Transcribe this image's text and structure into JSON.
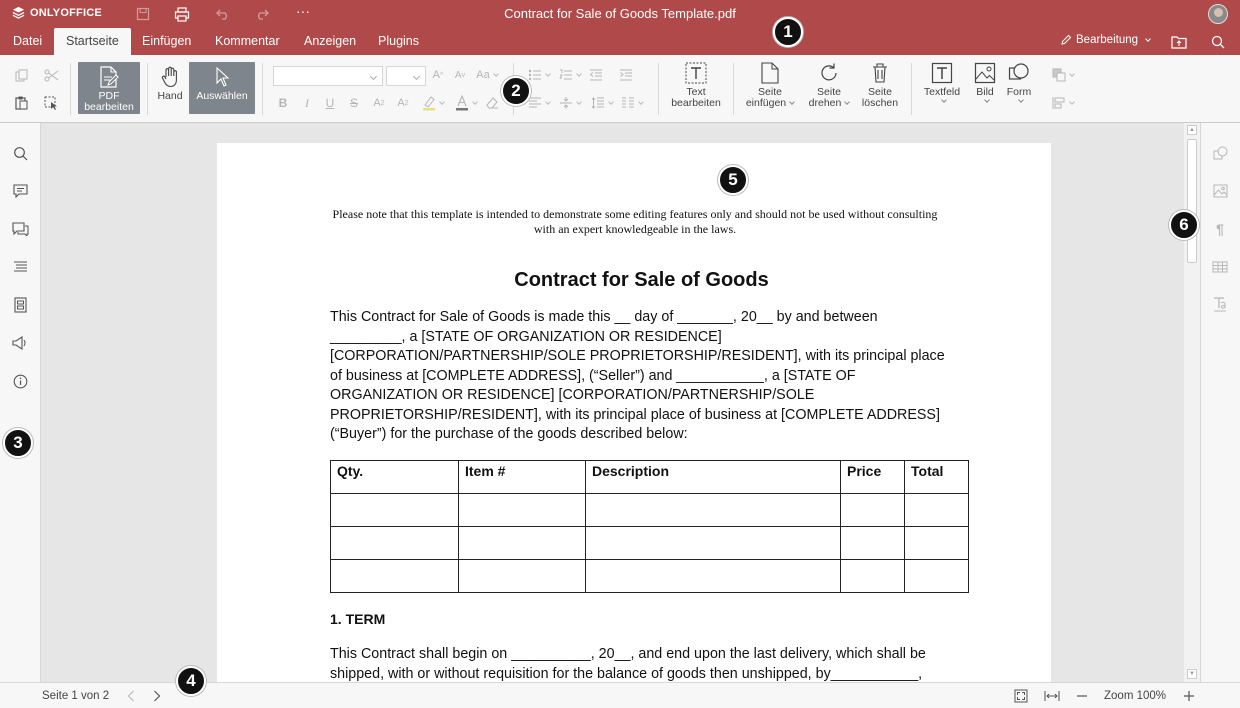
{
  "app": {
    "brand": "ONLYOFFICE",
    "title": "Contract for Sale of Goods Template.pdf",
    "accent_color": "#b04a4a"
  },
  "tabs": [
    {
      "label": "Datei"
    },
    {
      "label": "Startseite",
      "active": true
    },
    {
      "label": "Einfügen"
    },
    {
      "label": "Kommentar"
    },
    {
      "label": "Anzeigen"
    },
    {
      "label": "Plugins"
    }
  ],
  "mode": {
    "label": "Bearbeitung"
  },
  "toolbar": {
    "pdf_edit_line1": "PDF",
    "pdf_edit_line2": "bearbeiten",
    "hand_label": "Hand",
    "select_label": "Auswählen",
    "text_edit_line1": "Text",
    "text_edit_line2": "bearbeiten",
    "insert_page_line1": "Seite",
    "insert_page_line2": "einfügen",
    "rotate_page_line1": "Seite",
    "rotate_page_line2": "drehen",
    "delete_page_line1": "Seite",
    "delete_page_line2": "löschen",
    "textbox_label": "Textfeld",
    "image_label": "Bild",
    "shape_label": "Form"
  },
  "document": {
    "note": "Please note that this template is intended to demonstrate some editing features only and should not be used without consulting with an expert knowledgeable in the laws.",
    "heading": "Contract for Sale of Goods",
    "intro": "This Contract for Sale of Goods is made this __ day of _______, 20__ by and between _________, a [STATE OF ORGANIZATION OR RESIDENCE] [CORPORATION/PARTNERSHIP/SOLE PROPRIETORSHIP/RESIDENT], with its principal place of business at [COMPLETE ADDRESS], (“Seller”) and ___________, a [STATE OF ORGANIZATION OR RESIDENCE] [CORPORATION/PARTNERSHIP/SOLE PROPRIETORSHIP/RESIDENT], with its principal place of business at [COMPLETE ADDRESS] (“Buyer”) for the purchase of the goods described below:",
    "table_headers": [
      "Qty.",
      "Item #",
      "Description",
      "Price",
      "Total"
    ],
    "table_rows": [
      [
        "",
        "",
        "",
        "",
        ""
      ],
      [
        "",
        "",
        "",
        "",
        ""
      ],
      [
        "",
        "",
        "",
        "",
        ""
      ]
    ],
    "section_title": "1. TERM",
    "term_text": "This Contract shall begin on __________, 20__, and end upon the last delivery, which shall be shipped, with or without requisition for the balance of goods then unshipped, by___________,"
  },
  "status": {
    "page_info": "Seite 1 von 2",
    "zoom": "Zoom 100%"
  },
  "callouts": [
    "1",
    "2",
    "3",
    "4",
    "5",
    "6"
  ]
}
